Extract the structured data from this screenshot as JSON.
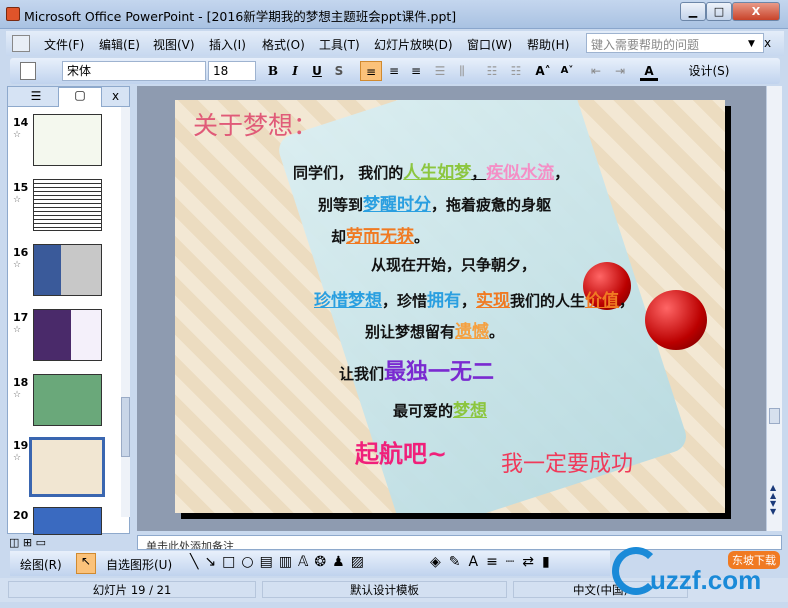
{
  "window": {
    "title": "Microsoft Office PowerPoint - [2016新学期我的梦想主题班会ppt课件.ppt]",
    "min": "▁",
    "max": "□",
    "close": "X"
  },
  "menu": {
    "items": [
      "文件(F)",
      "编辑(E)",
      "视图(V)",
      "插入(I)",
      "格式(O)",
      "工具(T)",
      "幻灯片放映(D)",
      "窗口(W)",
      "帮助(H)"
    ],
    "help_placeholder": "键入需要帮助的问题",
    "close": "x"
  },
  "toolbar": {
    "font": "宋体",
    "size": "18",
    "bold": "B",
    "italic": "I",
    "underline": "U",
    "shadow": "S",
    "grow": "A˄",
    "shrink": "A˅",
    "font_color": "A",
    "design": "设计(S)"
  },
  "pane": {
    "close": "x",
    "slides": [
      {
        "n": "14"
      },
      {
        "n": "15"
      },
      {
        "n": "16"
      },
      {
        "n": "17"
      },
      {
        "n": "18"
      },
      {
        "n": "19",
        "selected": true
      },
      {
        "n": "20"
      }
    ]
  },
  "slide": {
    "title": "关于梦想：",
    "lines": [
      [
        {
          "t": "同学们， 我们的"
        },
        {
          "t": "人生如梦",
          "c": "#8cc63f",
          "u": 1
        },
        {
          "t": "，",
          "u": 1
        },
        {
          "t": "疾似水流",
          "c": "#f48fc6",
          "u": 1
        },
        {
          "t": "，"
        }
      ],
      [
        {
          "t": "别等到"
        },
        {
          "t": "梦醒时分",
          "c": "#2a9fe0",
          "u": 1
        },
        {
          "t": "，拖着疲惫的身躯"
        }
      ],
      [
        {
          "t": "却"
        },
        {
          "t": "劳而无获",
          "c": "#f07a22",
          "u": 1
        },
        {
          "t": "。"
        }
      ],
      [
        {
          "t": "从现在开始，只争朝夕，"
        }
      ],
      [
        {
          "t": "珍惜梦想",
          "c": "#2a9fe0",
          "u": 1
        },
        {
          "t": "，珍惜"
        },
        {
          "t": "拥有",
          "c": "#2a9fe0"
        },
        {
          "t": "，"
        },
        {
          "t": "实现",
          "c": "#f07a22",
          "u": 1
        },
        {
          "t": "我们的人生"
        },
        {
          "t": "价值",
          "c": "#f07a22",
          "u": 1
        },
        {
          "t": "，"
        }
      ],
      [
        {
          "t": "别让梦想留有"
        },
        {
          "t": "遗憾",
          "c": "#f5a040",
          "u": 1
        },
        {
          "t": "。"
        }
      ],
      [
        {
          "t": "让我们"
        },
        {
          "t": "最独一无二",
          "c": "#7a2ad0"
        }
      ],
      [
        {
          "t": "最可爱的"
        },
        {
          "t": "梦想",
          "c": "#8cc63f",
          "u": 1
        }
      ]
    ],
    "sail": "起航吧~",
    "success": "我一定要成功"
  },
  "notes": {
    "placeholder": "单击此处添加备注"
  },
  "drawbar": {
    "draw": "绘图(R)",
    "autoshape": "自选图形(U)"
  },
  "status": {
    "slide": "幻灯片 19 / 21",
    "template": "默认设计模板",
    "lang": "中文(中国)"
  },
  "watermark": {
    "text": "uzzf.com",
    "sub": "东坡下载"
  }
}
